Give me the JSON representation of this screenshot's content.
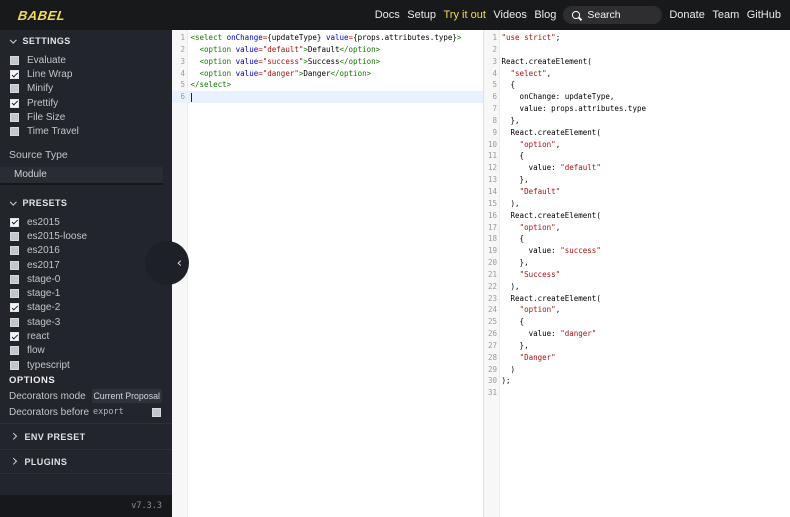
{
  "colors": {
    "accent": "#f5da55",
    "navbar_bg": "#18191b",
    "sidebar_bg": "#22252b",
    "footer_bg": "#17181c",
    "code_tag": "#117700",
    "code_attr": "#0000cc",
    "code_string": "#aa1111",
    "active_line": "#e8f2ff",
    "gutter_bg": "#f7f7f7"
  },
  "navbar": {
    "logo": "BABEL",
    "links": [
      {
        "label": "Docs",
        "active": false
      },
      {
        "label": "Setup",
        "active": false
      },
      {
        "label": "Try it out",
        "active": true
      },
      {
        "label": "Videos",
        "active": false
      },
      {
        "label": "Blog",
        "active": false
      }
    ],
    "search": {
      "placeholder": "Search"
    },
    "right_links": [
      {
        "label": "Donate"
      },
      {
        "label": "Team"
      },
      {
        "label": "GitHub"
      }
    ]
  },
  "sidebar": {
    "settings": {
      "header": "SETTINGS",
      "items": [
        {
          "label": "Evaluate",
          "checked": false
        },
        {
          "label": "Line Wrap",
          "checked": true
        },
        {
          "label": "Minify",
          "checked": false
        },
        {
          "label": "Prettify",
          "checked": true
        },
        {
          "label": "File Size",
          "checked": false
        },
        {
          "label": "Time Travel",
          "checked": false
        }
      ]
    },
    "source_type": {
      "label": "Source Type",
      "value": "Module"
    },
    "presets": {
      "header": "PRESETS",
      "items": [
        {
          "label": "es2015",
          "checked": true
        },
        {
          "label": "es2015-loose",
          "checked": false
        },
        {
          "label": "es2016",
          "checked": false
        },
        {
          "label": "es2017",
          "checked": false
        },
        {
          "label": "stage-0",
          "checked": false
        },
        {
          "label": "stage-1",
          "checked": false
        },
        {
          "label": "stage-2",
          "checked": true
        },
        {
          "label": "stage-3",
          "checked": false
        },
        {
          "label": "react",
          "checked": true
        },
        {
          "label": "flow",
          "checked": false
        },
        {
          "label": "typescript",
          "checked": false
        }
      ]
    },
    "options": {
      "header": "OPTIONS",
      "decorators_mode": {
        "label": "Decorators mode",
        "value": "Current Proposal"
      },
      "decorators_before": {
        "label": "Decorators before",
        "code": "export",
        "checked": false
      }
    },
    "collapsed": [
      {
        "label": "ENV PRESET"
      },
      {
        "label": "PLUGINS"
      }
    ],
    "version": "v7.3.3"
  },
  "editors": {
    "source": {
      "active_line": 6,
      "lines": [
        [
          [
            "tag",
            "<select"
          ],
          [
            "plain",
            " "
          ],
          [
            "attr",
            "onChange"
          ],
          [
            "eq",
            "="
          ],
          [
            "plain",
            "{updateType} "
          ],
          [
            "attr",
            "value"
          ],
          [
            "eq",
            "="
          ],
          [
            "plain",
            "{props.attributes.type}"
          ],
          [
            "tag",
            ">"
          ]
        ],
        [
          [
            "plain",
            "  "
          ],
          [
            "tag",
            "<option"
          ],
          [
            "plain",
            " "
          ],
          [
            "attr",
            "value"
          ],
          [
            "eq",
            "="
          ],
          [
            "str",
            "\"default\""
          ],
          [
            "tag",
            ">"
          ],
          [
            "plain",
            "Default"
          ],
          [
            "tag",
            "</option>"
          ]
        ],
        [
          [
            "plain",
            "  "
          ],
          [
            "tag",
            "<option"
          ],
          [
            "plain",
            " "
          ],
          [
            "attr",
            "value"
          ],
          [
            "eq",
            "="
          ],
          [
            "str",
            "\"success\""
          ],
          [
            "tag",
            ">"
          ],
          [
            "plain",
            "Success"
          ],
          [
            "tag",
            "</option>"
          ]
        ],
        [
          [
            "plain",
            "  "
          ],
          [
            "tag",
            "<option"
          ],
          [
            "plain",
            " "
          ],
          [
            "attr",
            "value"
          ],
          [
            "eq",
            "="
          ],
          [
            "str",
            "\"danger\""
          ],
          [
            "tag",
            ">"
          ],
          [
            "plain",
            "Danger"
          ],
          [
            "tag",
            "</option>"
          ]
        ],
        [
          [
            "tag",
            "</select>"
          ]
        ],
        []
      ]
    },
    "output": {
      "lines": [
        [
          [
            "str",
            "\"use strict\""
          ],
          [
            "plain",
            ";"
          ]
        ],
        [],
        [
          [
            "plain",
            "React.createElement("
          ]
        ],
        [
          [
            "plain",
            "  "
          ],
          [
            "str",
            "\"select\""
          ],
          [
            "plain",
            ","
          ]
        ],
        [
          [
            "plain",
            "  {"
          ]
        ],
        [
          [
            "plain",
            "    onChange: updateType,"
          ]
        ],
        [
          [
            "plain",
            "    value: props.attributes.type"
          ]
        ],
        [
          [
            "plain",
            "  },"
          ]
        ],
        [
          [
            "plain",
            "  React.createElement("
          ]
        ],
        [
          [
            "plain",
            "    "
          ],
          [
            "str",
            "\"option\""
          ],
          [
            "plain",
            ","
          ]
        ],
        [
          [
            "plain",
            "    {"
          ]
        ],
        [
          [
            "plain",
            "      value: "
          ],
          [
            "str",
            "\"default\""
          ]
        ],
        [
          [
            "plain",
            "    },"
          ]
        ],
        [
          [
            "plain",
            "    "
          ],
          [
            "str",
            "\"Default\""
          ]
        ],
        [
          [
            "plain",
            "  ),"
          ]
        ],
        [
          [
            "plain",
            "  React.createElement("
          ]
        ],
        [
          [
            "plain",
            "    "
          ],
          [
            "str",
            "\"option\""
          ],
          [
            "plain",
            ","
          ]
        ],
        [
          [
            "plain",
            "    {"
          ]
        ],
        [
          [
            "plain",
            "      value: "
          ],
          [
            "str",
            "\"success\""
          ]
        ],
        [
          [
            "plain",
            "    },"
          ]
        ],
        [
          [
            "plain",
            "    "
          ],
          [
            "str",
            "\"Success\""
          ]
        ],
        [
          [
            "plain",
            "  ),"
          ]
        ],
        [
          [
            "plain",
            "  React.createElement("
          ]
        ],
        [
          [
            "plain",
            "    "
          ],
          [
            "str",
            "\"option\""
          ],
          [
            "plain",
            ","
          ]
        ],
        [
          [
            "plain",
            "    {"
          ]
        ],
        [
          [
            "plain",
            "      value: "
          ],
          [
            "str",
            "\"danger\""
          ]
        ],
        [
          [
            "plain",
            "    },"
          ]
        ],
        [
          [
            "plain",
            "    "
          ],
          [
            "str",
            "\"Danger\""
          ]
        ],
        [
          [
            "plain",
            "  )"
          ]
        ],
        [
          [
            "plain",
            ");"
          ]
        ],
        []
      ]
    }
  }
}
